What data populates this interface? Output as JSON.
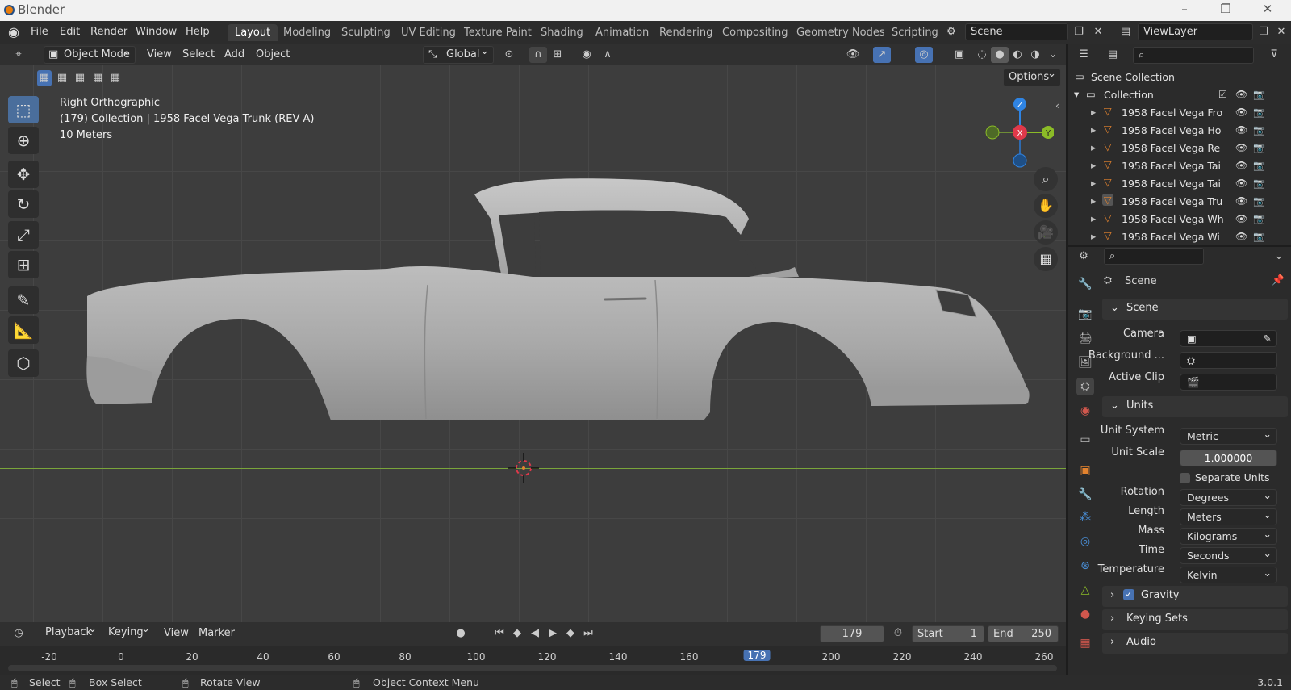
{
  "window": {
    "title": "Blender",
    "version": "3.0.1"
  },
  "menu": [
    "File",
    "Edit",
    "Render",
    "Window",
    "Help"
  ],
  "workspaces": [
    "Layout",
    "Modeling",
    "Sculpting",
    "UV Editing",
    "Texture Paint",
    "Shading",
    "Animation",
    "Rendering",
    "Compositing",
    "Geometry Nodes",
    "Scripting"
  ],
  "scene_name": "Scene",
  "view_layer": "ViewLayer",
  "viewport_header": {
    "mode": "Object Mode",
    "menus": [
      "View",
      "Select",
      "Add",
      "Object"
    ],
    "orientation": "Global",
    "options": "Options"
  },
  "viewport_overlay": {
    "view": "Right Orthographic",
    "collection": "(179) Collection | 1958 Facel Vega Trunk (REV A)",
    "scale": "10 Meters"
  },
  "gizmo": {
    "z": "Z",
    "x": "X",
    "y": "Y"
  },
  "outliner": {
    "root": "Scene Collection",
    "collection": "Collection",
    "items": [
      "1958 Facel Vega Fro",
      "1958 Facel Vega Ho",
      "1958 Facel Vega Re",
      "1958 Facel Vega Tai",
      "1958 Facel Vega Tai",
      "1958 Facel Vega Tru",
      "1958 Facel Vega Wh",
      "1958 Facel Vega Wi"
    ]
  },
  "properties": {
    "context": "Scene",
    "scene_panel": "Scene",
    "camera_label": "Camera",
    "background_label": "Background ...",
    "active_clip_label": "Active Clip",
    "units_panel": "Units",
    "unit_system_label": "Unit System",
    "unit_system": "Metric",
    "unit_scale_label": "Unit Scale",
    "unit_scale": "1.000000",
    "separate_units": "Separate Units",
    "rotation_label": "Rotation",
    "rotation": "Degrees",
    "length_label": "Length",
    "length": "Meters",
    "mass_label": "Mass",
    "mass": "Kilograms",
    "time_label": "Time",
    "time": "Seconds",
    "temperature_label": "Temperature",
    "temperature": "Kelvin",
    "gravity": "Gravity",
    "keying_sets": "Keying Sets",
    "audio": "Audio"
  },
  "timeline": {
    "menus": [
      "Playback",
      "Keying",
      "View",
      "Marker"
    ],
    "current_frame": "179",
    "start_label": "Start",
    "start": "1",
    "end_label": "End",
    "end": "250",
    "ticks": [
      "-20",
      "0",
      "20",
      "40",
      "60",
      "80",
      "100",
      "120",
      "140",
      "160",
      "179",
      "200",
      "220",
      "240",
      "260"
    ]
  },
  "statusbar": {
    "select": "Select",
    "box_select": "Box Select",
    "rotate_view": "Rotate View",
    "context_menu": "Object Context Menu"
  },
  "colors": {
    "accent": "#4772b3",
    "x_axis": "#e0394a",
    "y_axis": "#8bbb27",
    "z_axis": "#2f84e3",
    "object_icon": "#e4832e"
  }
}
